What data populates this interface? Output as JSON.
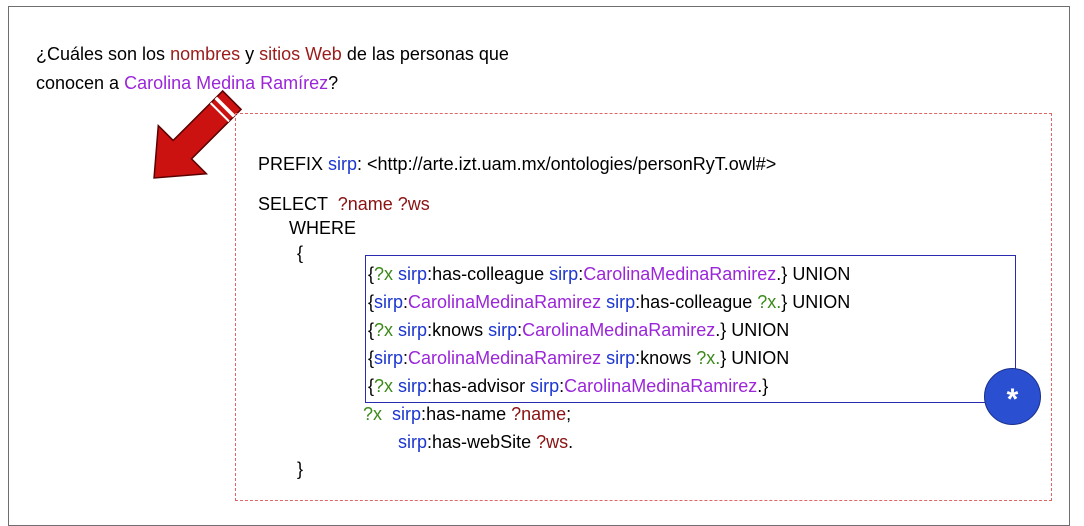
{
  "question": {
    "p1": "¿Cuáles son los ",
    "w_names": "nombres",
    "p2": " y ",
    "w_sites": "sitios Web",
    "p3": " de las personas que conocen a ",
    "w_person": "Carolina Medina Ramírez",
    "p4": "?"
  },
  "query": {
    "prefix_kw": "PREFIX ",
    "prefix_name": "sirp",
    "prefix_iri": ": <http://arte.izt.uam.mx/ontologies/personRyT.owl#>",
    "select_kw": "SELECT  ",
    "select_vars": "?name ?ws",
    "where_kw": "WHERE",
    "open_brace": "{",
    "close_brace": "}",
    "brace_l": "{",
    "brace_r": "}",
    "union_kw": " UNION",
    "var_x": "?x",
    "var_x_dot": "?x.",
    "ns": "sirp",
    "colon": ":",
    "p_colleague": "has-colleague",
    "p_knows": "knows",
    "p_advisor": "has-advisor",
    "p_name": "has-name",
    "p_website": "has-webSite",
    "entity": "CarolinaMedinaRamirez",
    "dot": ".",
    "semi": ";",
    "var_name": "?name",
    "var_ws": "?ws"
  },
  "badge": {
    "label": "*"
  },
  "colors": {
    "keyword_red": "#9b1b1b",
    "entity_purple": "#9b26d9",
    "namespace_blue": "#1c36cf",
    "variable_green": "#3c8a1c",
    "arrow_red": "#cc1111",
    "badge_blue": "#2a4fd1"
  },
  "icons": {
    "arrow": "down-right-arrow-icon"
  }
}
